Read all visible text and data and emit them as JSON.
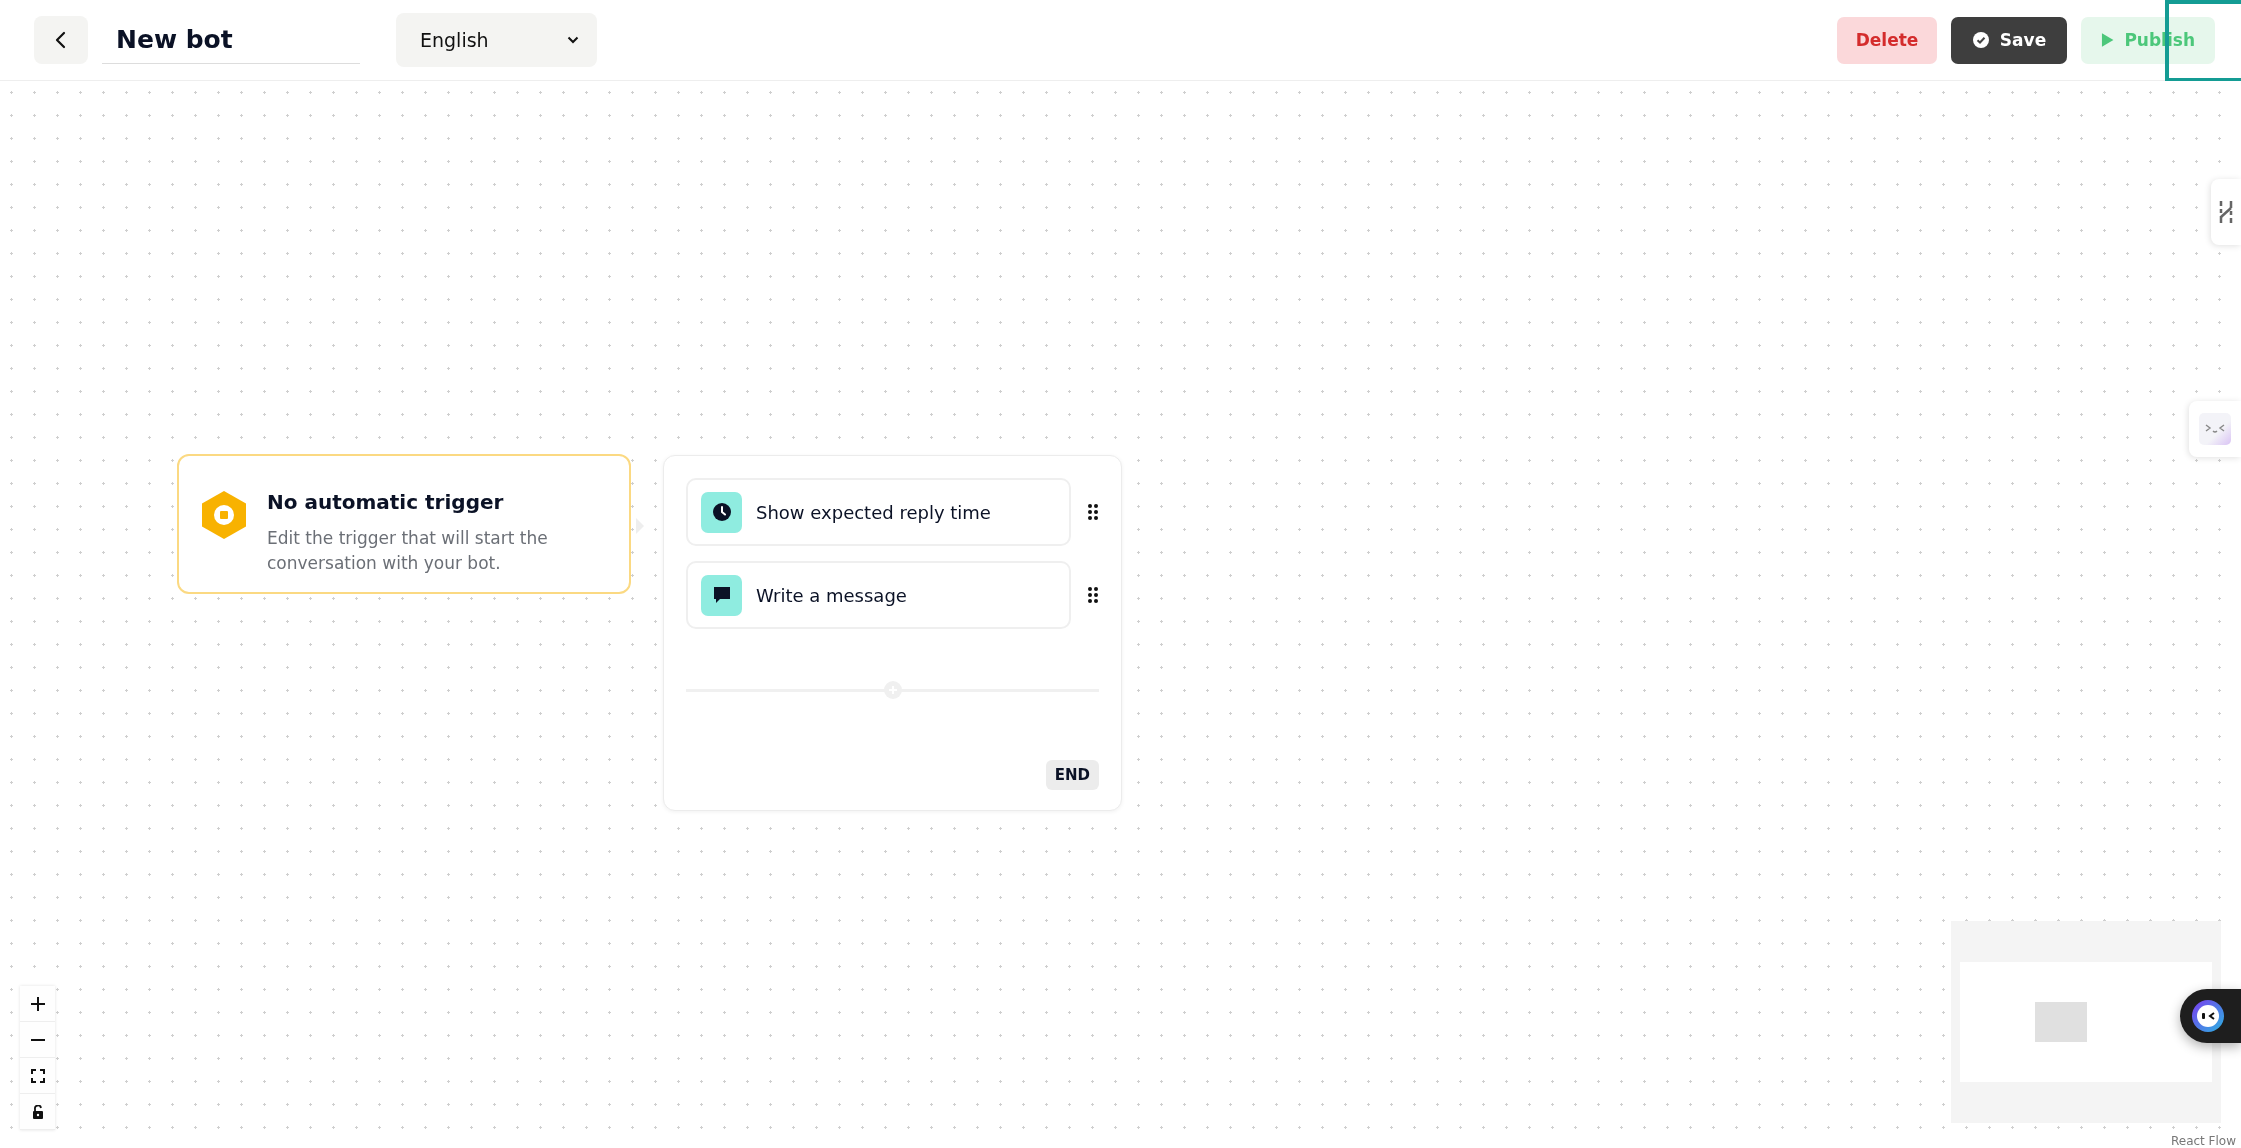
{
  "header": {
    "title": "New bot",
    "language": "English",
    "buttons": [
      {
        "label": "Delete",
        "kind": "danger"
      },
      {
        "label": "Save",
        "kind": "dark"
      },
      {
        "label": "Publish",
        "kind": "publish"
      }
    ]
  },
  "trigger": {
    "title": "No automatic trigger",
    "description": "Edit the trigger that will start the conversation with your bot."
  },
  "steps": [
    {
      "label": "Show expected reply time",
      "kind": "clock"
    },
    {
      "label": "Write a message",
      "kind": "message"
    }
  ],
  "end_label": "END",
  "attribution": "React Flow"
}
